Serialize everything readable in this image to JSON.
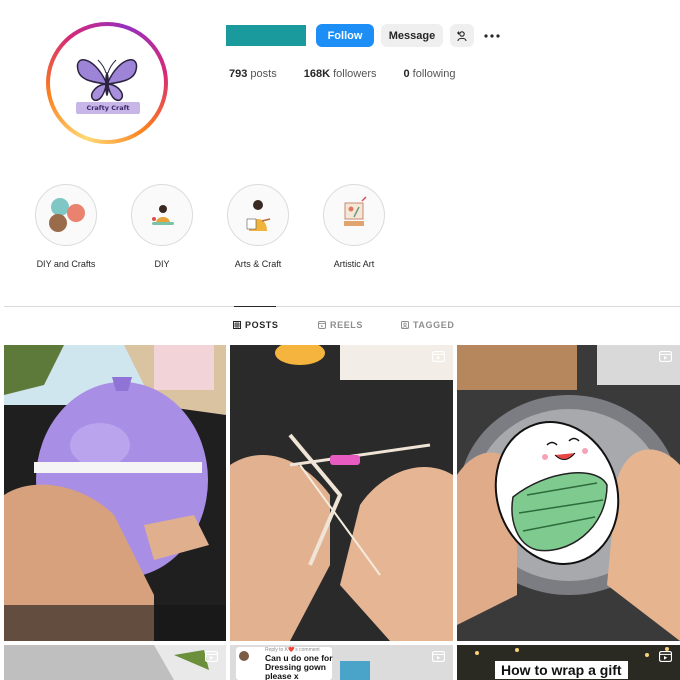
{
  "profile": {
    "avatar_text": "Crafty Craft",
    "follow_label": "Follow",
    "message_label": "Message",
    "add_user_icon": "person-add-icon",
    "more_icon": "ellipsis-icon",
    "stats": [
      {
        "value": "793",
        "label": "posts"
      },
      {
        "value": "168K",
        "label": "followers"
      },
      {
        "value": "0",
        "label": "following"
      }
    ]
  },
  "highlights": [
    {
      "label": "DIY and Crafts"
    },
    {
      "label": "DIY"
    },
    {
      "label": "Arts & Craft"
    },
    {
      "label": "Artistic Art"
    }
  ],
  "tabs": [
    {
      "label": "POSTS",
      "icon": "grid-icon",
      "active": true
    },
    {
      "label": "REELS",
      "icon": "reels-icon",
      "active": false
    },
    {
      "label": "TAGGED",
      "icon": "tagged-icon",
      "active": false
    }
  ],
  "posts": {
    "p5_overlay_small": "Reply to K❤️'s comment",
    "p5_overlay_text": "Can u do one for Dressing gown please x",
    "p6_overlay_text": "How to wrap a gift"
  },
  "colors": {
    "accent": "#1d8ef5",
    "username_placeholder": "#1a9a9c"
  }
}
